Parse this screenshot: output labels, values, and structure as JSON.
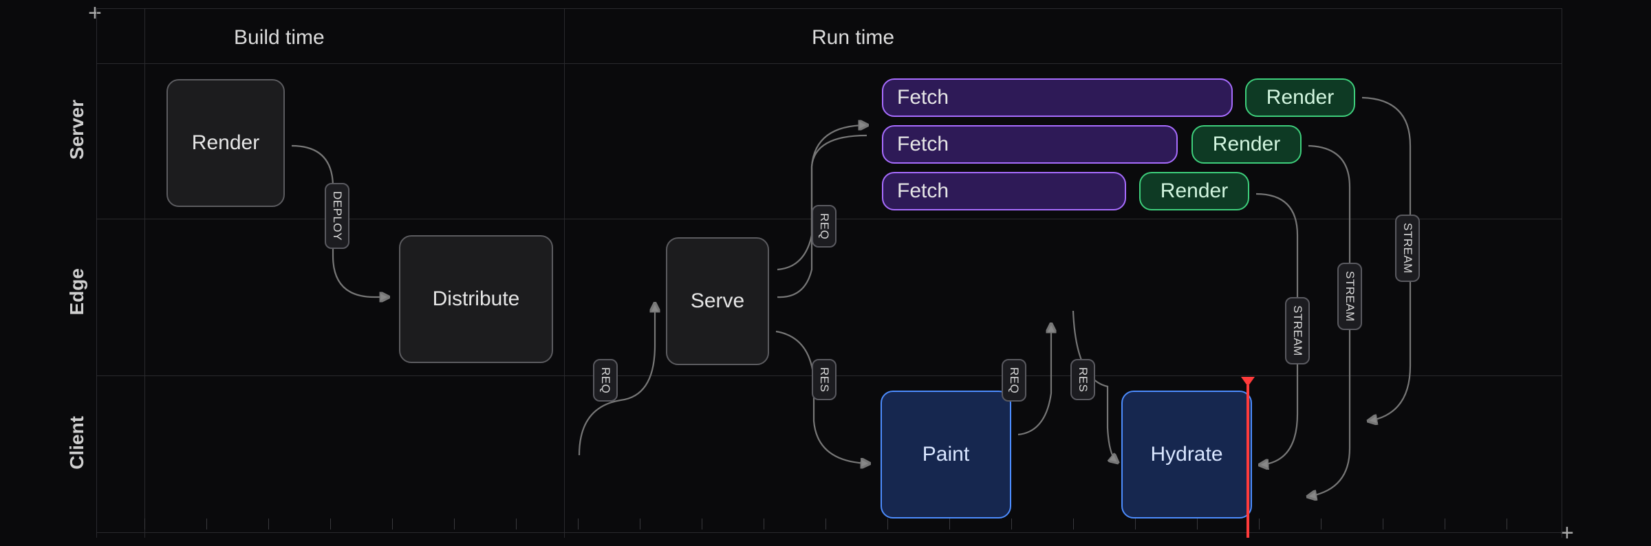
{
  "headers": {
    "build_time": "Build time",
    "run_time": "Run time"
  },
  "rows": {
    "server": "Server",
    "edge": "Edge",
    "client": "Client"
  },
  "nodes": {
    "render_build": "Render",
    "distribute": "Distribute",
    "serve": "Serve",
    "fetch1": "Fetch",
    "fetch2": "Fetch",
    "fetch3": "Fetch",
    "render1": "Render",
    "render2": "Render",
    "render3": "Render",
    "paint": "Paint",
    "hydrate": "Hydrate"
  },
  "arrow_labels": {
    "deploy": "DEPLOY",
    "req": "REQ",
    "res": "RES",
    "stream": "STREAM"
  },
  "corners": {
    "plus": "+"
  },
  "colors": {
    "purple_border": "#a86dff",
    "green_border": "#3ecf7c",
    "blue_border": "#4d8dff",
    "gray_border": "#5c5c60",
    "red_playhead": "#ff3b3b"
  }
}
